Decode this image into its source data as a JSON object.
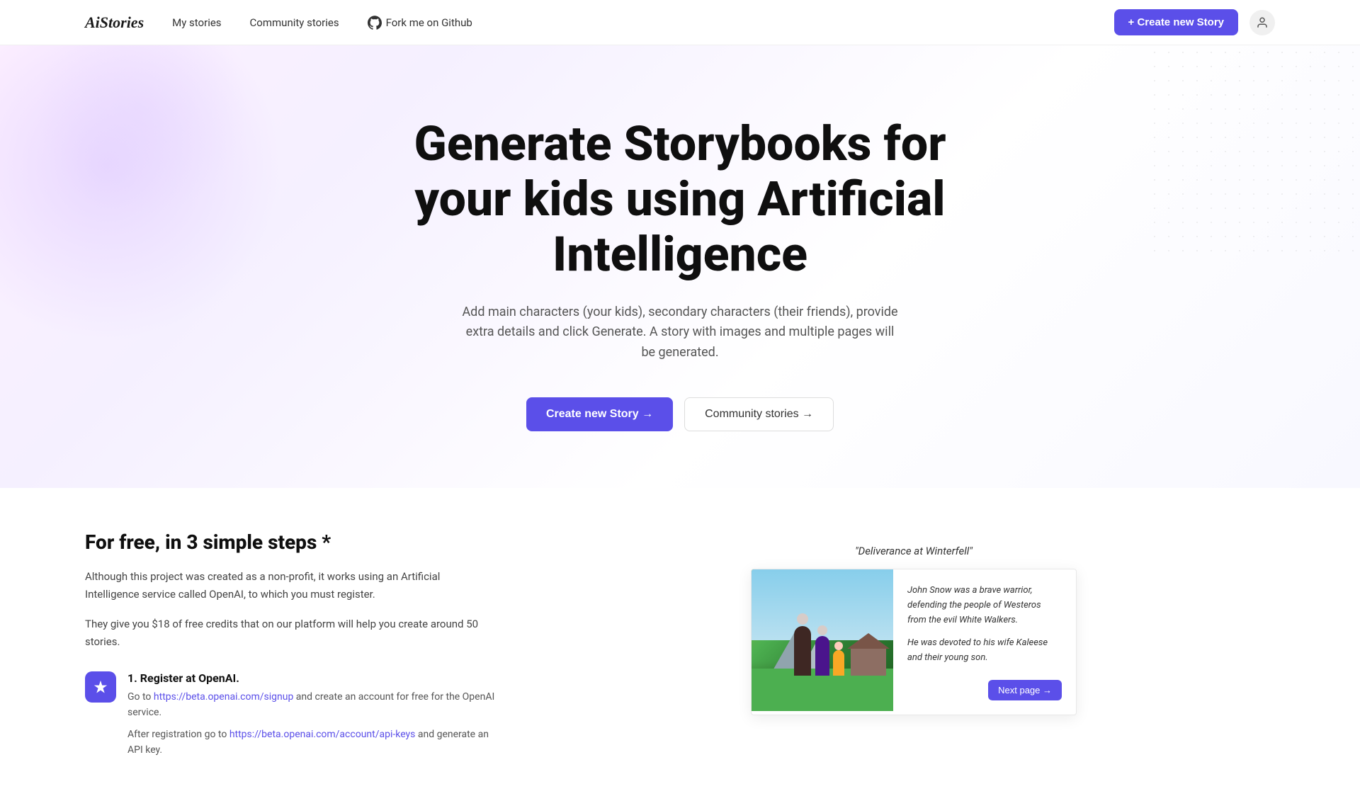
{
  "logo": "AiStories",
  "nav": {
    "my_stories": "My stories",
    "community_stories": "Community stories",
    "github_label": "Fork me on Github"
  },
  "header": {
    "create_btn": "+ Create new Story"
  },
  "hero": {
    "title": "Generate Storybooks for your kids using Artificial Intelligence",
    "subtitle": "Add main characters (your kids), secondary characters (their friends), provide extra details and click Generate. A story with images and multiple pages will be generated.",
    "create_btn": "Create new Story →",
    "community_btn": "Community stories →"
  },
  "steps_section": {
    "title": "For free, in 3 simple steps *",
    "desc1": "Although this project was created as a non-profit, it works using an Artificial Intelligence service called OpenAI, to which you must register.",
    "desc2": "They give you $18 of free credits that on our platform will help you create around 50 stories.",
    "step1": {
      "number": "1",
      "title": "1. Register at OpenAI.",
      "text_before": "Go to ",
      "link1_text": "https://beta.openai.com/signup",
      "link1_url": "https://beta.openai.com/signup",
      "text_after": " and create an account for free for the OpenAI service.",
      "text2_before": "After registration go to ",
      "link2_text": "https://beta.openai.com/account/api-keys",
      "link2_url": "https://beta.openai.com/account/api-keys",
      "text2_after": " and generate an API key."
    }
  },
  "book_preview": {
    "title": "\"Deliverance at Winterfell\"",
    "page_text1": "John Snow was a brave warrior, defending the people of Westeros from the evil White Walkers.",
    "page_text2": "He was devoted to his wife Kaleese and their young son.",
    "next_btn": "Next page →"
  }
}
